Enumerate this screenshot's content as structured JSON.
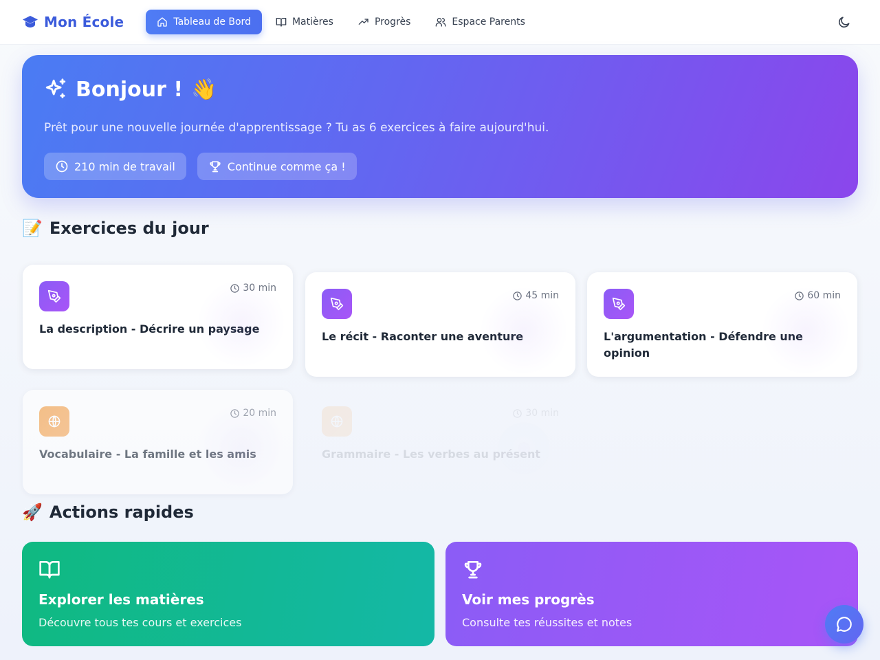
{
  "nav": {
    "brand": "Mon École",
    "brand_icon": "graduation-cap-icon",
    "items": [
      {
        "label": "Tableau de Bord",
        "icon": "home-icon",
        "active": true
      },
      {
        "label": "Matières",
        "icon": "book-open-icon",
        "active": false
      },
      {
        "label": "Progrès",
        "icon": "trending-up-icon",
        "active": false
      },
      {
        "label": "Espace Parents",
        "icon": "users-icon",
        "active": false
      }
    ],
    "theme_icon": "moon-icon"
  },
  "hero": {
    "title": "Bonjour !",
    "emoji": "👋",
    "subtitle": "Prêt pour une nouvelle journée d'apprentissage ? Tu as 6 exercices à faire aujourd'hui.",
    "pills": [
      {
        "label": "210 min de travail",
        "icon": "clock-icon"
      },
      {
        "label": "Continue comme ça !",
        "icon": "trophy-icon"
      }
    ]
  },
  "exercises": {
    "title": "Exercices du jour",
    "emoji": "📝",
    "cards": [
      {
        "title": "La description - Décrire un paysage",
        "time": "30 min",
        "icon": "pen-tool-icon",
        "color": "#8b5cf6"
      },
      {
        "title": "Le récit - Raconter une aventure",
        "time": "45 min",
        "icon": "pen-tool-icon",
        "color": "#8b5cf6"
      },
      {
        "title": "L'argumentation - Défendre une opinion",
        "time": "60 min",
        "icon": "pen-tool-icon",
        "color": "#8b5cf6"
      },
      {
        "title": "Vocabulaire - La famille et les amis",
        "time": "20 min",
        "icon": "globe-icon",
        "color": "#f59e42"
      },
      {
        "title": "Grammaire - Les verbes au présent",
        "time": "30 min",
        "icon": "globe-icon",
        "color": "#f59e42"
      }
    ]
  },
  "actions": {
    "title": "Actions rapides",
    "emoji": "🚀",
    "items": [
      {
        "title": "Explorer les matières",
        "desc": "Découvre tous tes cours et exercices",
        "icon": "book-open-icon",
        "color": "#10b981"
      },
      {
        "title": "Voir mes progrès",
        "desc": "Consulte tes réussites et notes",
        "icon": "trophy-icon",
        "color": "#8b5cf6"
      }
    ]
  },
  "chat": {
    "icon": "message-circle-icon"
  }
}
